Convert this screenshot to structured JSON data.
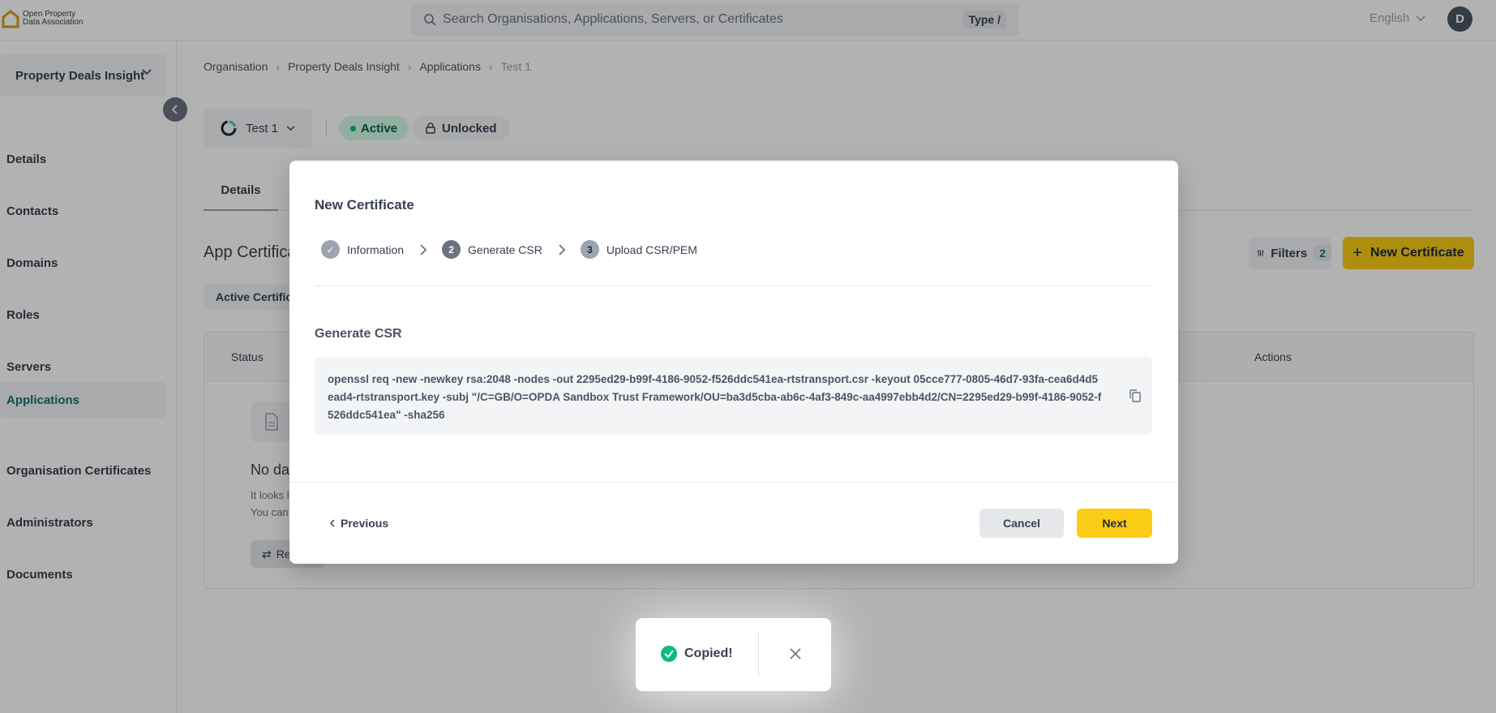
{
  "header": {
    "logo_text": "Open Property Data Association",
    "search_placeholder": "Search Organisations, Applications, Servers, or Certificates",
    "type_hint": "Type /",
    "language": "English",
    "avatar_initial": "D"
  },
  "sidebar": {
    "org_name": "Property Deals Insight",
    "items": [
      {
        "label": "Details"
      },
      {
        "label": "Contacts"
      },
      {
        "label": "Domains"
      },
      {
        "label": "Roles"
      },
      {
        "label": "Servers"
      },
      {
        "label": "Applications"
      },
      {
        "label": "Organisation Certificates"
      },
      {
        "label": "Administrators"
      },
      {
        "label": "Documents"
      }
    ]
  },
  "breadcrumb": [
    "Organisation",
    "Property Deals Insight",
    "Applications",
    "Test 1"
  ],
  "app": {
    "name": "Test 1",
    "status": "Active",
    "lock": "Unlocked"
  },
  "tabs": {
    "details": "Details"
  },
  "certificates": {
    "title": "App Certifica",
    "filters_label": "Filters",
    "filters_count": "2",
    "new_button": "New Certificate",
    "subtab": "Active Certificates",
    "col_status": "Status",
    "col_actions": "Actions",
    "empty_title": "No dat",
    "empty_line1": "It looks l",
    "empty_line2": "You can",
    "retry": "Re"
  },
  "modal": {
    "title": "New Certificate",
    "steps": [
      {
        "label": "Information",
        "state": "done"
      },
      {
        "number": "2",
        "label": "Generate CSR",
        "state": "current"
      },
      {
        "number": "3",
        "label": "Upload CSR/PEM",
        "state": "upcoming"
      }
    ],
    "section_label": "Generate CSR",
    "command": "openssl req -new -newkey rsa:2048 -nodes -out 2295ed29-b99f-4186-9052-f526ddc541ea-rtstransport.csr -keyout 05cce777-0805-46d7-93fa-cea6d4d5ead4-rtstransport.key -subj \"/C=GB/O=OPDA Sandbox Trust Framework/OU=ba3d5cba-ab6c-4af3-849c-aa4997ebb4d2/CN=2295ed29-b99f-4186-9052-f526ddc541ea\" -sha256",
    "previous": "Previous",
    "cancel": "Cancel",
    "next": "Next"
  },
  "toast": {
    "message": "Copied!"
  },
  "colors": {
    "accent_yellow": "#facc15",
    "active_teal": "#0f766e",
    "success_green": "#10b981"
  }
}
